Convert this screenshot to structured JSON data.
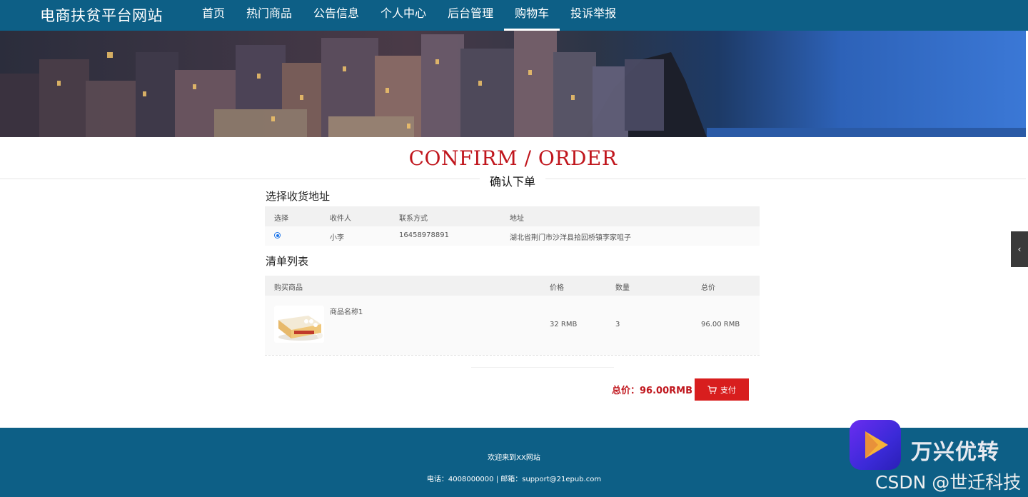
{
  "header": {
    "brand": "电商扶贫平台网站",
    "nav": [
      "首页",
      "热门商品",
      "公告信息",
      "个人中心",
      "后台管理",
      "购物车",
      "投诉举报"
    ],
    "active_nav": "购物车"
  },
  "page": {
    "title_en": "CONFIRM / ORDER",
    "title_cn": "确认下单"
  },
  "address_section": {
    "title": "选择收货地址",
    "columns": [
      "选择",
      "收件人",
      "联系方式",
      "地址"
    ],
    "rows": [
      {
        "selected": true,
        "recipient": "小李",
        "phone": "16458978891",
        "address": "湖北省荆门市沙洋县拾回桥镇李家咀子"
      }
    ]
  },
  "items_section": {
    "title": "清单列表",
    "columns": [
      "购买商品",
      "价格",
      "数量",
      "总价"
    ],
    "rows": [
      {
        "name": "商品名称1",
        "price": "32 RMB",
        "quantity": "3",
        "subtotal": "96.00 RMB",
        "image_icon": "product-box-icon"
      }
    ]
  },
  "order": {
    "total_label": "总价：96.00RMB",
    "pay_label": "支付",
    "pay_icon": "cart-icon"
  },
  "footer": {
    "welcome": "欢迎来到XX网站",
    "contact": "电话：4008000000 | 邮箱：support@21epub.com"
  },
  "watermark": {
    "title": "万兴优转",
    "csdn": "CSDN @世迁科技"
  },
  "colors": {
    "nav_bg": "#0d5f86",
    "title_red": "#c0161d",
    "pay_button": "#d81e1e"
  }
}
